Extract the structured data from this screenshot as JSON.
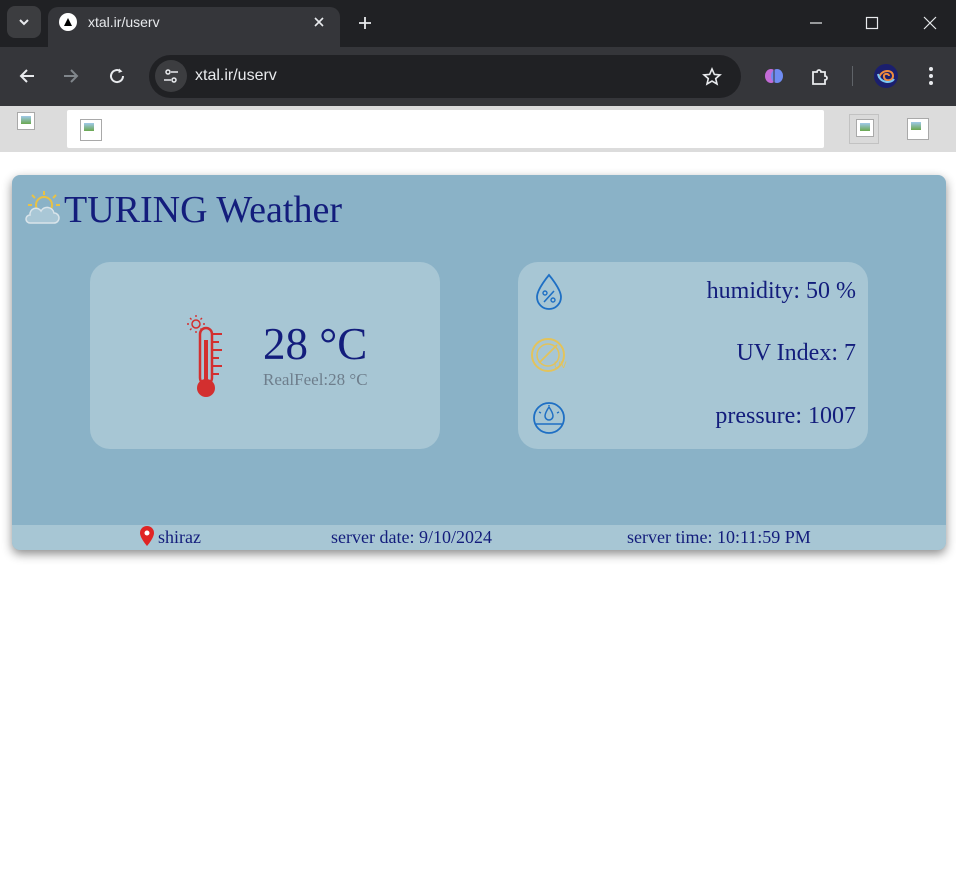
{
  "browser": {
    "tab_title": "xtal.ir/userv",
    "url": "xtal.ir/userv",
    "icons": [
      "tab-search-icon",
      "close-icon",
      "plus-icon",
      "minimize-icon",
      "maximize-icon",
      "close-window-icon",
      "back-icon",
      "forward-icon",
      "reload-icon",
      "site-info-icon",
      "star-icon",
      "brain-extension-icon",
      "puzzle-icon",
      "profile-avatar-icon",
      "more-menu-icon"
    ]
  },
  "page_header": {
    "icons": [
      "broken-logo-image",
      "broken-search-image",
      "broken-icon-image",
      "broken-icon-image"
    ]
  },
  "weather": {
    "title": "TURING Weather",
    "temperature": "28 °C",
    "realfeel_label": "RealFeel:",
    "realfeel_value": "28 °C",
    "humidity": "humidity: 50 %",
    "uv_index": "UV Index: 7",
    "pressure": "pressure: 1007",
    "location": "shiraz",
    "server_date": "server date: 9/10/2024",
    "server_time": "server time: 10:11:59 PM",
    "colors": {
      "card": "#8ab2c7",
      "panel": "#a7c6d4",
      "text": "#131d7c",
      "thermometer": "#d32f2f",
      "info_icons": "#1e6fc4",
      "uv_icon": "#e3c35b"
    }
  }
}
